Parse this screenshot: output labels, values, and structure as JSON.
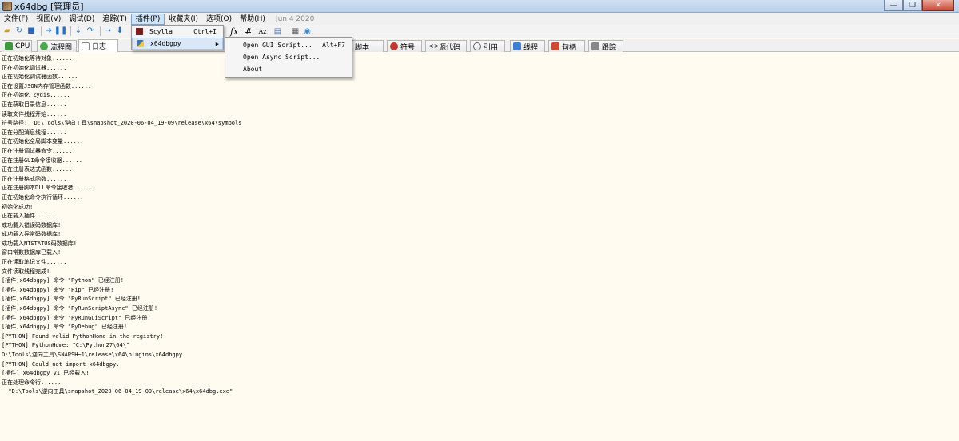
{
  "window": {
    "title": "x64dbg [管理员]",
    "buttons": [
      "—",
      "❐",
      "✕"
    ]
  },
  "menubar": {
    "items": [
      "文件(F)",
      "视图(V)",
      "调试(D)",
      "追踪(T)",
      "插件(P)",
      "收藏夹(I)",
      "选项(O)",
      "帮助(H)"
    ],
    "date": "Jun 4 2020"
  },
  "toolbar": {
    "fx": "fx",
    "hash": "#",
    "az": "Az"
  },
  "tabs": {
    "cpu": "CPU",
    "graph": "流程图",
    "log": "日志",
    "script": "脚本",
    "symbols": "符号",
    "source": "源代码",
    "references": "引用",
    "threads": "线程",
    "handles": "句柄",
    "trace": "跟踪"
  },
  "plugin_menu": {
    "items": [
      {
        "label": "Scylla",
        "shortcut": "Ctrl+I"
      },
      {
        "label": "x64dbgpy",
        "shortcut": ""
      }
    ],
    "submenu_arrow": "▶"
  },
  "submenu": {
    "items": [
      {
        "label": "Open GUI Script...",
        "shortcut": "Alt+F7"
      },
      {
        "label": "Open Async Script...",
        "shortcut": ""
      },
      {
        "label": "About",
        "shortcut": ""
      }
    ]
  },
  "log_lines": [
    "正在初始化等待对象......",
    "正在初始化调试器......",
    "正在初始化调试器函数......",
    "正在设置JSON内存管理函数......",
    "正在初始化 Zydis......",
    "正在获取目录信息......",
    "读取文件线程开始......",
    "符号路径:  D:\\Tools\\逆向工具\\snapshot_2020-06-04_19-09\\release\\x64\\symbols",
    "正在分配消息线程......",
    "正在初始化全局脚本变量......",
    "正在注册调试器命令......",
    "正在注册GUI命令接收器......",
    "正在注册表达式函数......",
    "正在注册格式函数......",
    "正在注册脚本DLL命令接收者......",
    "正在初始化命令执行循环......",
    "初始化成功!",
    "正在载入插件......",
    "成功载入错误码数据库!",
    "成功载入异常码数据库!",
    "成功载入NTSTATUS码数据库!",
    "窗口常数数据库已载入!",
    "正在读取笔记文件......",
    "文件读取线程完成!",
    "[插件,x64dbgpy] 命令 \"Python\" 已经注册!",
    "[插件,x64dbgpy] 命令 \"Pip\" 已经注册!",
    "[插件,x64dbgpy] 命令 \"PyRunScript\" 已经注册!",
    "[插件,x64dbgpy] 命令 \"PyRunScriptAsync\" 已经注册!",
    "[插件,x64dbgpy] 命令 \"PyRunGuiScript\" 已经注册!",
    "[插件,x64dbgpy] 命令 \"PyDebug\" 已经注册!",
    "[PYTHON] Found valid PythonHome in the registry!",
    "[PYTHON] PythonHome: \"C:\\Python27\\64\\\"",
    "D:\\Tools\\逆向工具\\SNAPSH~1\\release\\x64\\plugins\\x64dbgpy",
    "[PYTHON] Could not import x64dbgpy.",
    "[插件] x64dbgpy v1 已经载入!",
    "正在处理命令行......",
    "  \"D:\\Tools\\逆向工具\\snapshot_2020-06-04_19-09\\release\\x64\\x64dbg.exe\""
  ]
}
